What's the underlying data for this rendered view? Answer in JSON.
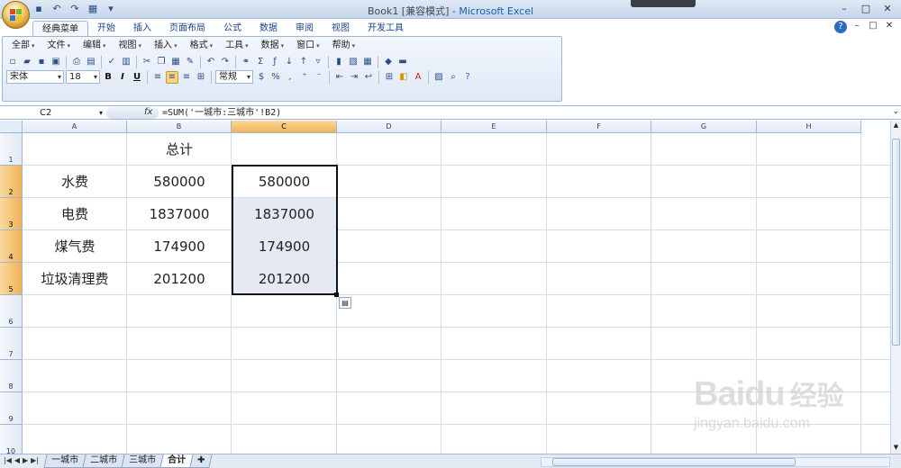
{
  "window": {
    "title": "Book1  [兼容模式] - ",
    "app_name": "Microsoft Excel",
    "minimize": "–",
    "maximize": "□",
    "close": "✕"
  },
  "ribbon_tabs": [
    "经典菜单",
    "开始",
    "插入",
    "页面布局",
    "公式",
    "数据",
    "审阅",
    "视图",
    "开发工具"
  ],
  "active_tab": "经典菜单",
  "classic_menu": [
    "全部",
    "文件",
    "编辑",
    "视图",
    "插入",
    "格式",
    "工具",
    "数据",
    "窗口",
    "帮助"
  ],
  "font": {
    "name": "宋体",
    "size": "18"
  },
  "number_format": "常规",
  "formula_bar": {
    "name_box": "C2",
    "fx_label": "fx",
    "formula": "=SUM('一城市:三城市'!B2)"
  },
  "columns": [
    "A",
    "B",
    "C",
    "D",
    "E",
    "F",
    "G",
    "H"
  ],
  "rows": [
    "1",
    "2",
    "3",
    "4",
    "5",
    "6",
    "7",
    "8",
    "9",
    "10"
  ],
  "cells": {
    "B1": "总计",
    "A2": "水费",
    "B2": "580000",
    "C2": "580000",
    "A3": "电费",
    "B3": "1837000",
    "C3": "1837000",
    "A4": "煤气费",
    "B4": "174900",
    "C4": "174900",
    "A5": "垃圾清理费",
    "B5": "201200",
    "C5": "201200"
  },
  "selection": "C2:C5",
  "sheet_tabs": [
    "一城市",
    "二城市",
    "三城市",
    "合计"
  ],
  "active_sheet": "合计",
  "watermark": {
    "brand": "Bai",
    "brand2": "du",
    "cn": "经验",
    "url": "jingyan.baidu.com"
  }
}
